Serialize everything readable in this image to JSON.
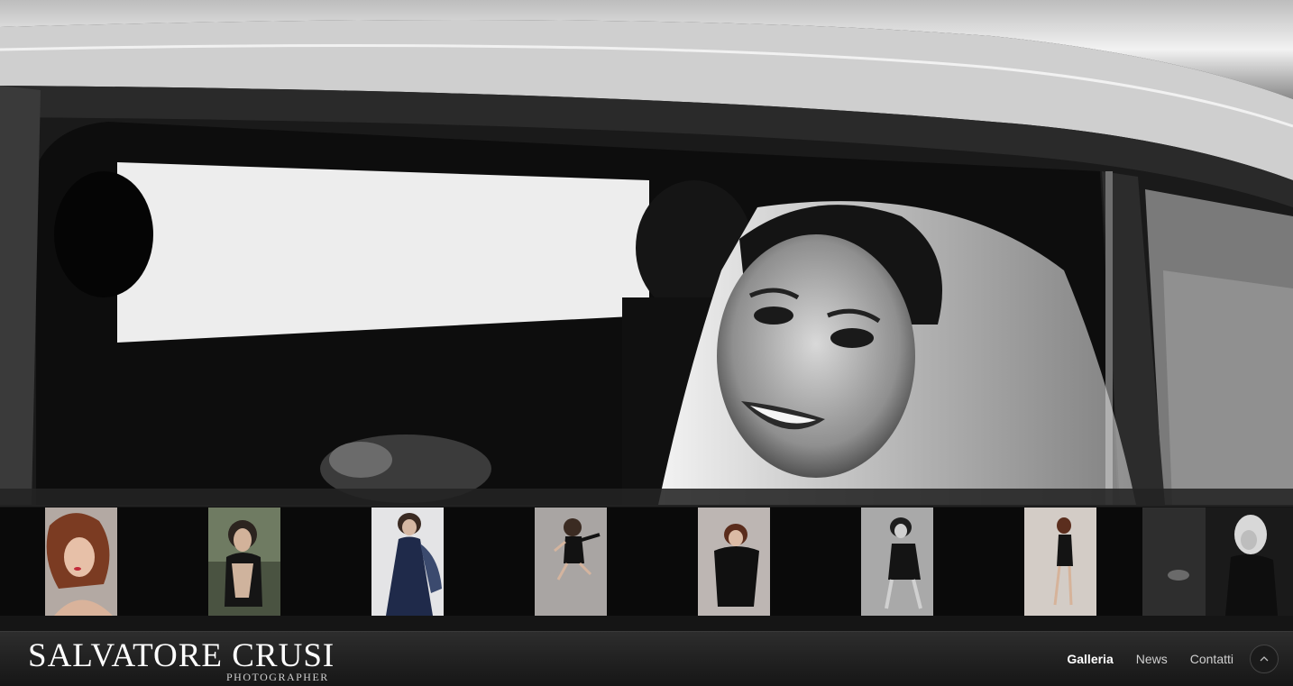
{
  "site": {
    "name": "SALVATORE CRUSI",
    "tagline": "PHOTOGRAPHER"
  },
  "nav": {
    "items": [
      {
        "label": "Galleria",
        "active": true
      },
      {
        "label": "News",
        "active": false
      },
      {
        "label": "Contatti",
        "active": false
      }
    ],
    "scroll_top_icon": "chevron-up-icon"
  },
  "hero": {
    "subject": "bride-in-car-window-photo"
  },
  "gallery": {
    "thumbnails": [
      {
        "icon": "portrait-redhead-thumb"
      },
      {
        "icon": "portrait-outdoor-thumb"
      },
      {
        "icon": "portrait-blue-dress-thumb"
      },
      {
        "icon": "portrait-jump-thumb"
      },
      {
        "icon": "portrait-black-dress-thumb"
      },
      {
        "icon": "portrait-crouch-thumb"
      },
      {
        "icon": "portrait-standing-thumb"
      },
      {
        "icon": "portrait-blonde-thumb"
      }
    ]
  },
  "colors": {
    "footer_bg": "#222222",
    "nav_active": "#ffffff",
    "nav_inactive": "#cfcfcf"
  }
}
